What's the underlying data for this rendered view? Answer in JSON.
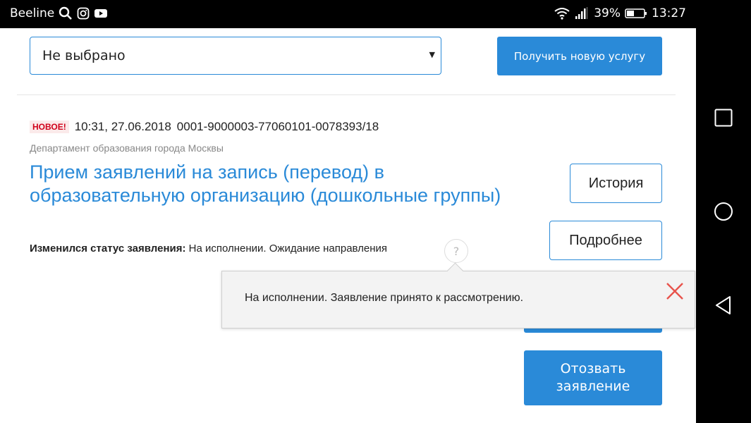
{
  "status_bar": {
    "carrier": "Beeline",
    "battery": "39%",
    "time": "13:27",
    "icons": [
      "search-icon",
      "instagram-icon",
      "youtube-icon",
      "wifi-icon",
      "signal-icon",
      "battery-icon"
    ]
  },
  "nav_bar": {
    "icons": [
      "recent-apps-icon",
      "home-icon",
      "back-icon"
    ]
  },
  "filter": {
    "select_value": "Не выбрано",
    "new_service_label": "Получить новую услугу"
  },
  "application": {
    "badge": "НОВОЕ!",
    "datetime": "10:31, 27.06.2018",
    "number": "0001-9000003-77060101-0078393/18",
    "department": "Департамент образования города Москвы",
    "title": "Прием заявлений на запись (перевод) в образовательную организацию (дошкольные группы)",
    "status_label": "Изменился статус заявления:",
    "status_value": "На исполнении. Ожидание направления",
    "help_label": "?",
    "history_label": "История",
    "details_label": "Подробнее",
    "withdraw_label": "Отозвать заявление"
  },
  "popover": {
    "text": "На исполнении. Заявление принято к рассмотрению."
  },
  "colors": {
    "accent": "#2a8ad8",
    "badge_red": "#d0021b"
  }
}
